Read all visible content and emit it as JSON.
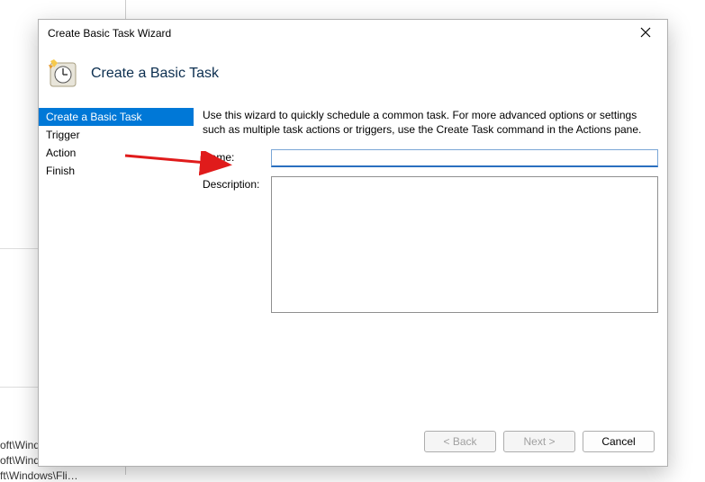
{
  "background": {
    "tree_item_a": "oft\\Windo…",
    "tree_item_b": "oft\\Windows\\O…",
    "tree_item_c": "ft\\Windows\\Fli…"
  },
  "dialog": {
    "title": "Create Basic Task Wizard",
    "heading": "Create a Basic Task"
  },
  "sidebar": {
    "items": [
      {
        "label": "Create a Basic Task",
        "active": true
      },
      {
        "label": "Trigger",
        "active": false
      },
      {
        "label": "Action",
        "active": false
      },
      {
        "label": "Finish",
        "active": false
      }
    ]
  },
  "main": {
    "intro": "Use this wizard to quickly schedule a common task.  For more advanced options or settings such as multiple task actions or triggers, use the Create Task command in the Actions pane.",
    "name_label": "Name:",
    "name_value": "",
    "desc_label": "Description:",
    "desc_value": ""
  },
  "footer": {
    "back": "< Back",
    "next": "Next >",
    "cancel": "Cancel"
  }
}
